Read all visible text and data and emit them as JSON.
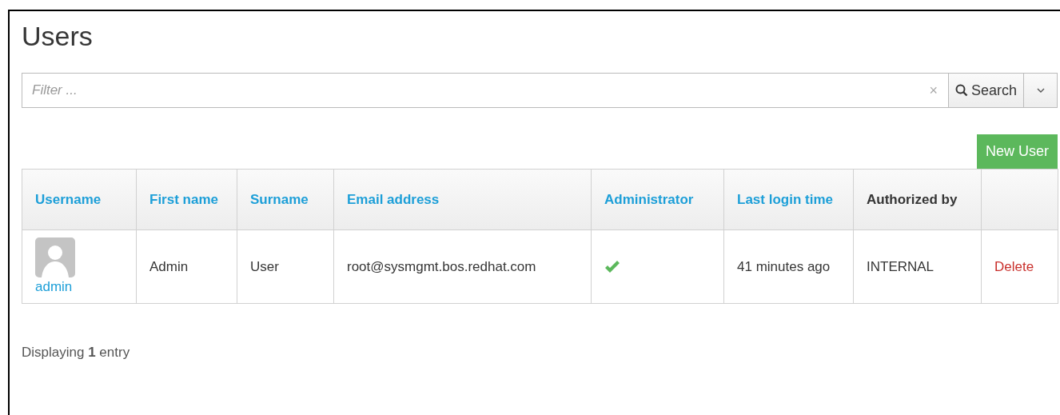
{
  "title": "Users",
  "filter": {
    "placeholder": "Filter ...",
    "clear": "×",
    "search_button": "Search"
  },
  "new_user_button": "New User",
  "table": {
    "columns": [
      {
        "label": "Username",
        "sortable": true
      },
      {
        "label": "First name",
        "sortable": true
      },
      {
        "label": "Surname",
        "sortable": true
      },
      {
        "label": "Email address",
        "sortable": true
      },
      {
        "label": "Administrator",
        "sortable": true
      },
      {
        "label": "Last login time",
        "sortable": true
      },
      {
        "label": "Authorized by",
        "sortable": false
      }
    ],
    "rows": [
      {
        "username": "admin",
        "first_name": "Admin",
        "surname": "User",
        "email": "root@sysmgmt.bos.redhat.com",
        "administrator": true,
        "last_login": "41 minutes ago",
        "authorized_by": "INTERNAL",
        "action": "Delete"
      }
    ]
  },
  "footer": "Displaying **1** entry"
}
